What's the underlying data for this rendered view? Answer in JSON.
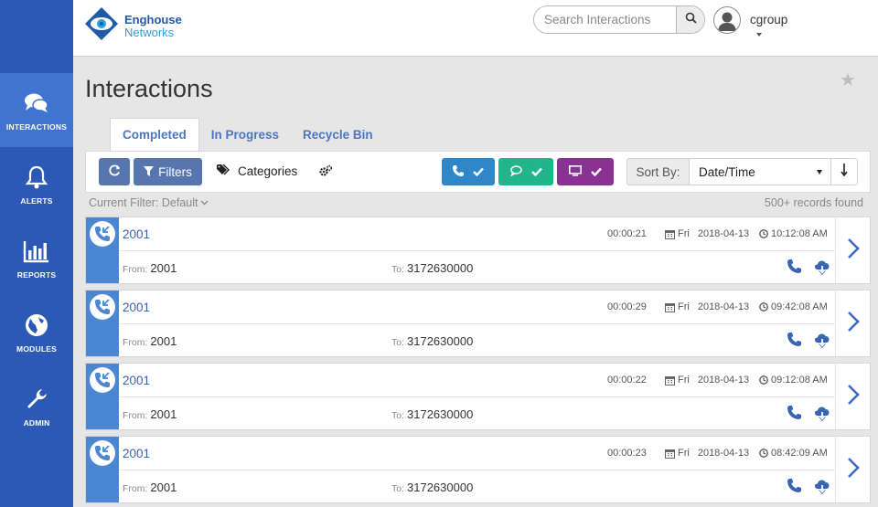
{
  "brand": {
    "line1": "Enghouse",
    "line2": "Networks"
  },
  "sidebar": {
    "items": [
      {
        "label": "INTERACTIONS",
        "icon": "chat-bubbles-icon",
        "active": true
      },
      {
        "label": "ALERTS",
        "icon": "bell-icon",
        "active": false
      },
      {
        "label": "REPORTS",
        "icon": "bar-chart-icon",
        "active": false
      },
      {
        "label": "MODULES",
        "icon": "globe-icon",
        "active": false
      },
      {
        "label": "ADMIN",
        "icon": "wrench-icon",
        "active": false
      }
    ]
  },
  "header": {
    "search_placeholder": "Search Interactions",
    "username": "cgroup"
  },
  "page": {
    "title": "Interactions"
  },
  "tabs": [
    {
      "label": "Completed",
      "active": true
    },
    {
      "label": "In Progress",
      "active": false
    },
    {
      "label": "Recycle Bin",
      "active": false
    }
  ],
  "toolbar": {
    "filters_label": "Filters",
    "categories_label": "Categories",
    "sort_by_label": "Sort By:",
    "sort_value": "Date/Time"
  },
  "filter_status": {
    "current": "Current Filter: Default",
    "records": "500+ records found"
  },
  "colors": {
    "sidebar": "#2b59b5",
    "phone_filter": "#2f86c8",
    "chat_filter": "#22b58a",
    "screen_filter": "#8a3294",
    "accent": "#4a86d3"
  },
  "interactions": [
    {
      "ext": "2001",
      "duration": "00:00:21",
      "day": "Fri",
      "date": "2018-04-13",
      "time": "10:12:08 AM",
      "from_label": "From:",
      "from": "2001",
      "to_label": "To:",
      "to": "3172630000"
    },
    {
      "ext": "2001",
      "duration": "00:00:29",
      "day": "Fri",
      "date": "2018-04-13",
      "time": "09:42:08 AM",
      "from_label": "From:",
      "from": "2001",
      "to_label": "To:",
      "to": "3172630000"
    },
    {
      "ext": "2001",
      "duration": "00:00:22",
      "day": "Fri",
      "date": "2018-04-13",
      "time": "09:12:08 AM",
      "from_label": "From:",
      "from": "2001",
      "to_label": "To:",
      "to": "3172630000"
    },
    {
      "ext": "2001",
      "duration": "00:00:23",
      "day": "Fri",
      "date": "2018-04-13",
      "time": "08:42:09 AM",
      "from_label": "From:",
      "from": "2001",
      "to_label": "To:",
      "to": "3172630000"
    }
  ]
}
